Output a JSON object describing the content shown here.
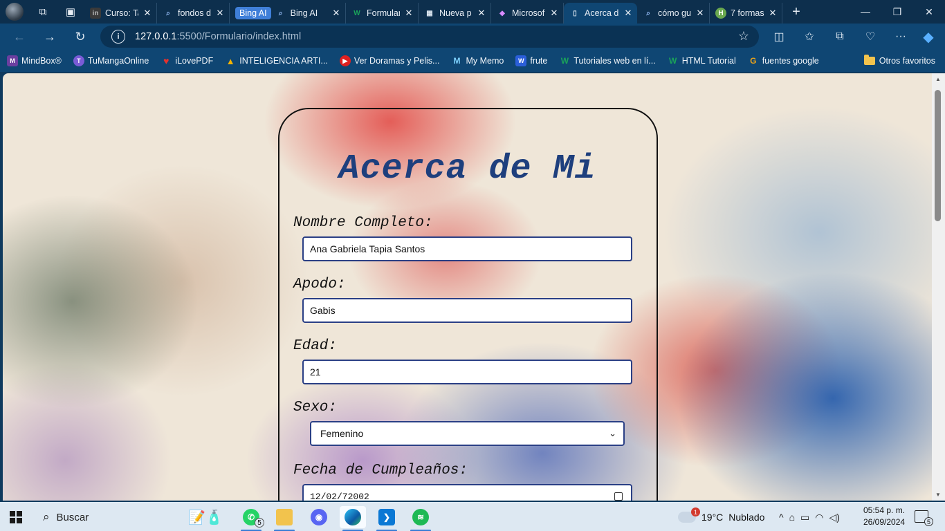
{
  "tabs": [
    {
      "title": "Curso: Ta",
      "favicon": "in",
      "color": "#4a4a4a"
    },
    {
      "title": "fondos d",
      "favicon": "⌕",
      "color": "#0f4673"
    },
    {
      "title": "Bing AI",
      "favicon": "⌕",
      "color": "#0f4673"
    },
    {
      "title": "Formular",
      "favicon": "W",
      "color": "#1aa35a"
    },
    {
      "title": "Nueva p",
      "favicon": "▦",
      "color": "#0f4673"
    },
    {
      "title": "Microsof",
      "favicon": "◆",
      "color": "#c14bd6"
    },
    {
      "title": "Acerca d",
      "favicon": "▯",
      "color": "#0f4673"
    },
    {
      "title": "cómo gu",
      "favicon": "⌕",
      "color": "#0f4673"
    },
    {
      "title": "7 formas",
      "favicon": "H",
      "color": "#6aa84f"
    }
  ],
  "bing_chip": "Bing AI",
  "address": {
    "host": "127.0.0.1",
    "path": ":5500/Formulario/index.html"
  },
  "bookmarks": [
    {
      "label": "MindBox®",
      "color": "#6b3fa0",
      "icon": "M"
    },
    {
      "label": "TuMangaOnline",
      "color": "#7a5bd6",
      "icon": "T"
    },
    {
      "label": "iLovePDF",
      "color": "#e5322d",
      "icon": "♥"
    },
    {
      "label": "INTELIGENCIA ARTI...",
      "color": "#2f9e44",
      "icon": "▲"
    },
    {
      "label": "Ver Doramas y Pelis...",
      "color": "#e02020",
      "icon": "▶"
    },
    {
      "label": "My Memo",
      "color": "#2b8ec4",
      "icon": "M"
    },
    {
      "label": "frute",
      "color": "#2b5fd9",
      "icon": "W"
    },
    {
      "label": "Tutoriales web en lí...",
      "color": "#1aa35a",
      "icon": "W"
    },
    {
      "label": "HTML Tutorial",
      "color": "#1aa35a",
      "icon": "W"
    },
    {
      "label": "fuentes google",
      "color": "#e8a21a",
      "icon": "G"
    }
  ],
  "other_favorites": "Otros favoritos",
  "form": {
    "title": "Acerca de Mi",
    "nombre_label": "Nombre Completo:",
    "nombre_value": "Ana Gabriela Tapia Santos",
    "apodo_label": "Apodo:",
    "apodo_value": "Gabis",
    "edad_label": "Edad:",
    "edad_value": "21",
    "sexo_label": "Sexo:",
    "sexo_value": "Femenino",
    "fecha_label": "Fecha de Cumpleaños:",
    "fecha_value": "12/02/72002"
  },
  "taskbar": {
    "search_label": "Buscar",
    "whatsapp_badge": "5",
    "weather_temp": "19°C",
    "weather_desc": "Nublado",
    "weather_alert": "1",
    "time": "05:54 p. m.",
    "date": "26/09/2024",
    "notifications": "5"
  }
}
